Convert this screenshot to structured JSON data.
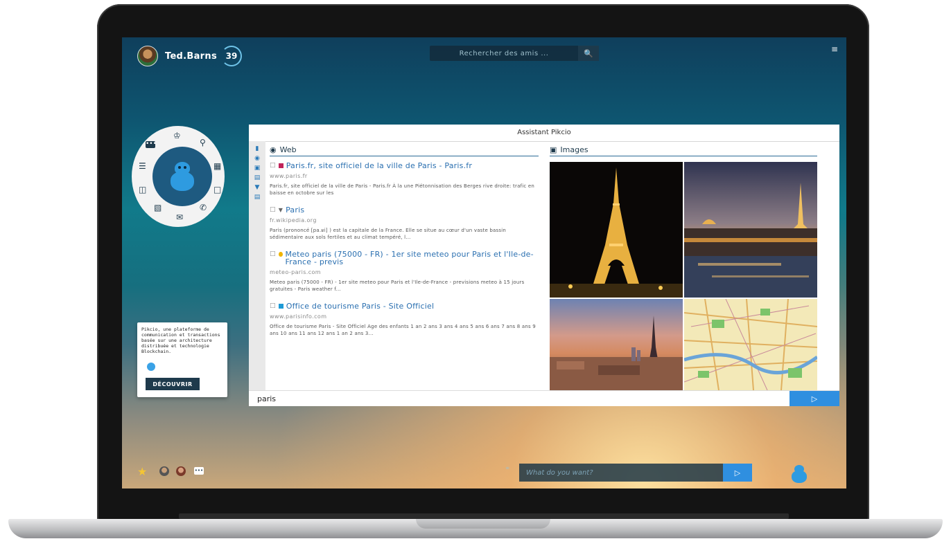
{
  "header": {
    "username": "Ted.Barns",
    "notification_count": "39",
    "search_placeholder": "Rechercher des amis ...",
    "menu_icon": "hamburger-icon"
  },
  "promo": {
    "text": "Pikcio, une plateforme de communication et transactions basée sur une architecture distribuée et technologie Blockchain.",
    "button_label": "DÉCOUVRIR"
  },
  "assistant": {
    "title": "Assistant Pikcio",
    "web_heading": "Web",
    "images_heading": "Images",
    "results": [
      {
        "title": "Paris.fr, site officiel de la ville de Paris - Paris.fr",
        "url": "www.paris.fr",
        "description": "Paris.fr, site officiel de la ville de Paris - Paris.fr À la une Piétonnisation des Berges rive droite: trafic en baisse en octobre sur les",
        "favicon_color": "#c0245a"
      },
      {
        "title": "Paris",
        "url": "fr.wikipedia.org",
        "description": "Paris (prononcé [pa.ʁi] ) est la capitale de la France. Elle se situe au cœur d'un vaste bassin sédimentaire aux sols fertiles et au climat tempéré, l...",
        "favicon_color": "#666666"
      },
      {
        "title": "Meteo paris (75000 - FR) - 1er site meteo pour Paris et l'Ile-de-France - previs",
        "url": "meteo-paris.com",
        "description": "Meteo paris (75000 - FR) - 1er site meteo pour Paris et l'Ile-de-France - previsions meteo à 15 jours gratuites - Paris weather f...",
        "favicon_color": "#f0b400"
      },
      {
        "title": "Office de tourisme Paris - Site Officiel",
        "url": "www.parisinfo.com",
        "description": "Office de tourisme Paris - Site Officiel Age des enfants 1 an 2 ans 3 ans 4 ans 5 ans 6 ans 7 ans 8 ans 9 ans 10 ans 11 ans 12 ans 1 an 2 ans 3...",
        "favicon_color": "#1e9ad6"
      }
    ],
    "query": "paris"
  },
  "bottom": {
    "input_placeholder": "What do you want?"
  },
  "colors": {
    "accent": "#2f8fe0",
    "dark_navy": "#1e3a4c",
    "link": "#2a6fb0"
  }
}
